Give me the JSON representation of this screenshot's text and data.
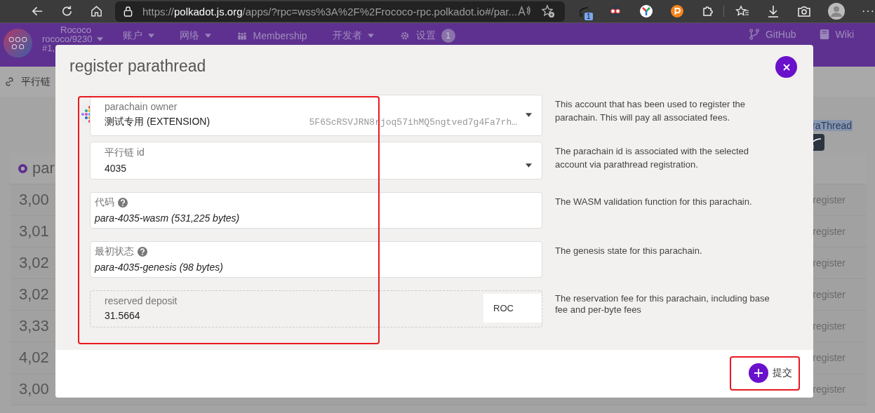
{
  "browser": {
    "url_scheme": "https://",
    "url_host": "polkadot.js.org",
    "url_rest": "/apps/?rpc=wss%3A%2F%2Frococo-rpc.polkadot.io#/par...",
    "extension_badge": "1",
    "menu": "···"
  },
  "app_header": {
    "chain": "Rococo",
    "node": "rococo/9230",
    "block": "#1,",
    "nav": [
      {
        "label": "账户",
        "kind": "dropdown"
      },
      {
        "label": "网络",
        "kind": "dropdown"
      },
      {
        "label": "Membership",
        "kind": "people"
      },
      {
        "label": "开发者",
        "kind": "dropdown"
      },
      {
        "label": "设置",
        "kind": "settings",
        "badge": "1"
      }
    ],
    "links": [
      {
        "label": "GitHub",
        "kind": "code"
      },
      {
        "label": "Wiki",
        "kind": "docs"
      }
    ]
  },
  "subnav": {
    "label": "平行链"
  },
  "background_page": {
    "selected_text": "raThread",
    "table_heading": "par",
    "rows": [
      {
        "column_1": "3,00",
        "column_2": "register"
      },
      {
        "column_1": "3,01",
        "column_2": "register"
      },
      {
        "column_1": "3,02",
        "column_2": "register"
      },
      {
        "column_1": "3,02",
        "column_2": "register"
      },
      {
        "column_1": "3,33",
        "column_2": "register"
      },
      {
        "column_1": "4,02",
        "column_2": "register"
      },
      {
        "column_1": "3,00",
        "column_2": "register"
      }
    ]
  },
  "modal": {
    "title": "register parathread",
    "fields": [
      {
        "kind": "account",
        "label": "parachain owner",
        "value": "测试专用 (EXTENSION)",
        "address": "5F6ScRSVJRN8rjoq57ihMQ5ngtved7g4Fa7rh…",
        "help": "This account that has been used to register the parachain. This will pay all associated fees."
      },
      {
        "kind": "dropdown",
        "label": "平行链 id",
        "value": "4035",
        "help": "The parachain id is associated with the selected account via parathread registration."
      },
      {
        "kind": "file",
        "label": "代码",
        "info": true,
        "value": "para-4035-wasm (531,225 bytes)",
        "help": "The WASM validation function for this parachain."
      },
      {
        "kind": "file",
        "label": "最初状态",
        "info": true,
        "value": "para-4035-genesis (98 bytes)",
        "help": "The genesis state for this parachain."
      },
      {
        "kind": "amount",
        "label": "reserved deposit",
        "value": "31.5664",
        "unit": "ROC",
        "help": "The reservation fee for this parachain, including base fee and per-byte fees"
      }
    ],
    "submit": "提交"
  }
}
